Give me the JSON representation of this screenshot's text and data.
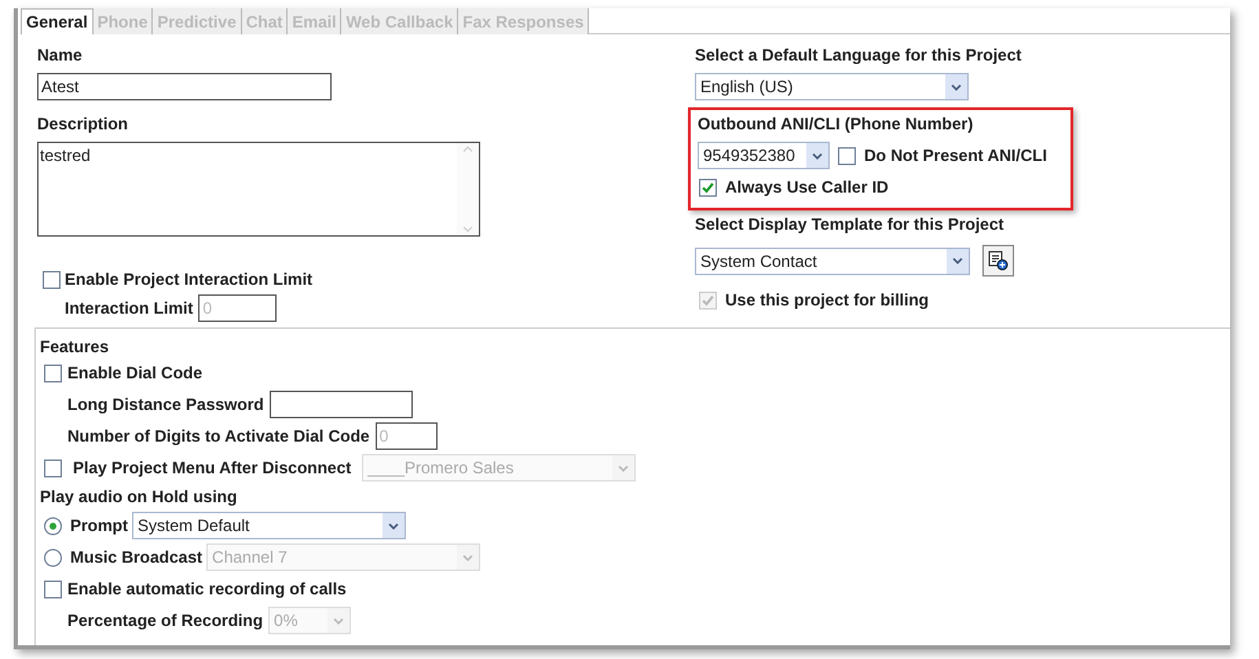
{
  "tabs": [
    {
      "label": "General",
      "selected": true
    },
    {
      "label": "Phone",
      "selected": false
    },
    {
      "label": "Predictive",
      "selected": false
    },
    {
      "label": "Chat",
      "selected": false
    },
    {
      "label": "Email",
      "selected": false
    },
    {
      "label": "Web Callback",
      "selected": false
    },
    {
      "label": "Fax Responses",
      "selected": false
    }
  ],
  "name": {
    "label": "Name",
    "value": "Atest"
  },
  "description": {
    "label": "Description",
    "value": "testred"
  },
  "interaction_limit": {
    "label": "Enable Project Interaction Limit",
    "checked": false
  },
  "interaction_limit_field": {
    "label": "Interaction Limit",
    "value": "0",
    "disabled": true
  },
  "language": {
    "label": "Select a Default Language for this Project",
    "value": "English (US)"
  },
  "outbound": {
    "label": "Outbound ANI/CLI (Phone Number)",
    "value": "9549352380",
    "highlighted": true,
    "do_not_present": {
      "label": "Do Not Present ANI/CLI",
      "checked": false
    },
    "always_caller_id": {
      "label": "Always Use Caller ID",
      "checked": true
    }
  },
  "template": {
    "label": "Select Display Template for this Project",
    "value": "System Contact"
  },
  "billing": {
    "label": "Use this project for billing",
    "checked": true,
    "disabled": true
  },
  "features": {
    "title": "Features",
    "items": [
      {
        "kind": "checkbox",
        "label": "Enable Dial Code",
        "checked": false
      },
      {
        "kind": "field",
        "label": "Long Distance Password"
      },
      {
        "kind": "field",
        "label": "Number of Digits to Activate Dial Code",
        "value": "0",
        "disabled": true
      },
      {
        "kind": "checkselect",
        "label": "Play Project Menu After Disconnect",
        "checked": false,
        "value": "____Promero Sales",
        "disabled": true
      },
      {
        "kind": "heading",
        "label": "Play audio on Hold using"
      },
      {
        "kind": "radio",
        "label": "Prompt",
        "selected": true,
        "value": "System Default",
        "disabled": false
      },
      {
        "kind": "radio",
        "label": "Music Broadcast",
        "selected": false,
        "value": "Channel 7",
        "disabled": true
      },
      {
        "kind": "checkbox",
        "label": "Enable automatic recording of calls",
        "checked": false
      },
      {
        "kind": "select",
        "label": "Percentage of Recording",
        "value": "0%",
        "disabled": true
      }
    ]
  }
}
